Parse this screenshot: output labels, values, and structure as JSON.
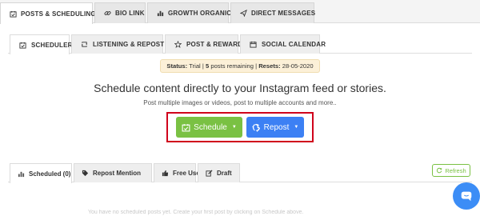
{
  "top_tabs": [
    {
      "label": "POSTS & SCHEDULING",
      "icon": "calendar-check-icon",
      "active": true
    },
    {
      "label": "BIO LINK",
      "icon": "link-icon",
      "active": false
    },
    {
      "label": "GROWTH ORGANIC",
      "icon": "bar-chart-icon",
      "active": false
    },
    {
      "label": "DIRECT MESSAGES",
      "icon": "paper-plane-icon",
      "active": false
    }
  ],
  "sub_tabs": [
    {
      "label": "SCHEDULER",
      "icon": "calendar-check-icon",
      "active": true
    },
    {
      "label": "LISTENING & REPOST",
      "icon": "retweet-icon",
      "active": false
    },
    {
      "label": "POST & REWARD",
      "icon": "star-icon",
      "active": false
    },
    {
      "label": "SOCIAL CALENDAR",
      "icon": "calendar-icon",
      "active": false
    }
  ],
  "status": {
    "prefix": "Status:",
    "plan": "Trial",
    "sep1": "|",
    "count": "5",
    "remaining": "posts remaining",
    "sep2": "|",
    "resets_label": "Resets:",
    "resets_date": "28-05-2020",
    "background": "#fcf0d8"
  },
  "main": {
    "headline": "Schedule content directly to your Instagram feed or stories.",
    "subline": "Post multiple images or videos, post to multiple accounts and more..",
    "schedule_button": {
      "label": "Schedule",
      "icon": "calendar-check-icon",
      "color": "#7ac143"
    },
    "repost_button": {
      "label": "Repost",
      "icon": "recycle-icon",
      "color": "#3c80f4"
    },
    "highlight_color": "#d0021b"
  },
  "bottom_tabs": [
    {
      "label": "Scheduled (0)",
      "icon": "bar-chart-icon",
      "active": true
    },
    {
      "label": "Repost Mention",
      "icon": "tag-icon",
      "active": false
    },
    {
      "label": "Free Use",
      "icon": "thumbs-up-icon",
      "active": false
    },
    {
      "label": "Draft",
      "icon": "edit-icon",
      "active": false
    }
  ],
  "refresh": {
    "label": "Refresh",
    "icon": "refresh-icon",
    "color": "#7ac143"
  },
  "faint_text": "You have no scheduled posts yet. Create your first post by clicking on Schedule above.",
  "chat": {
    "icon": "chat-icon",
    "color": "#3c8df6"
  }
}
